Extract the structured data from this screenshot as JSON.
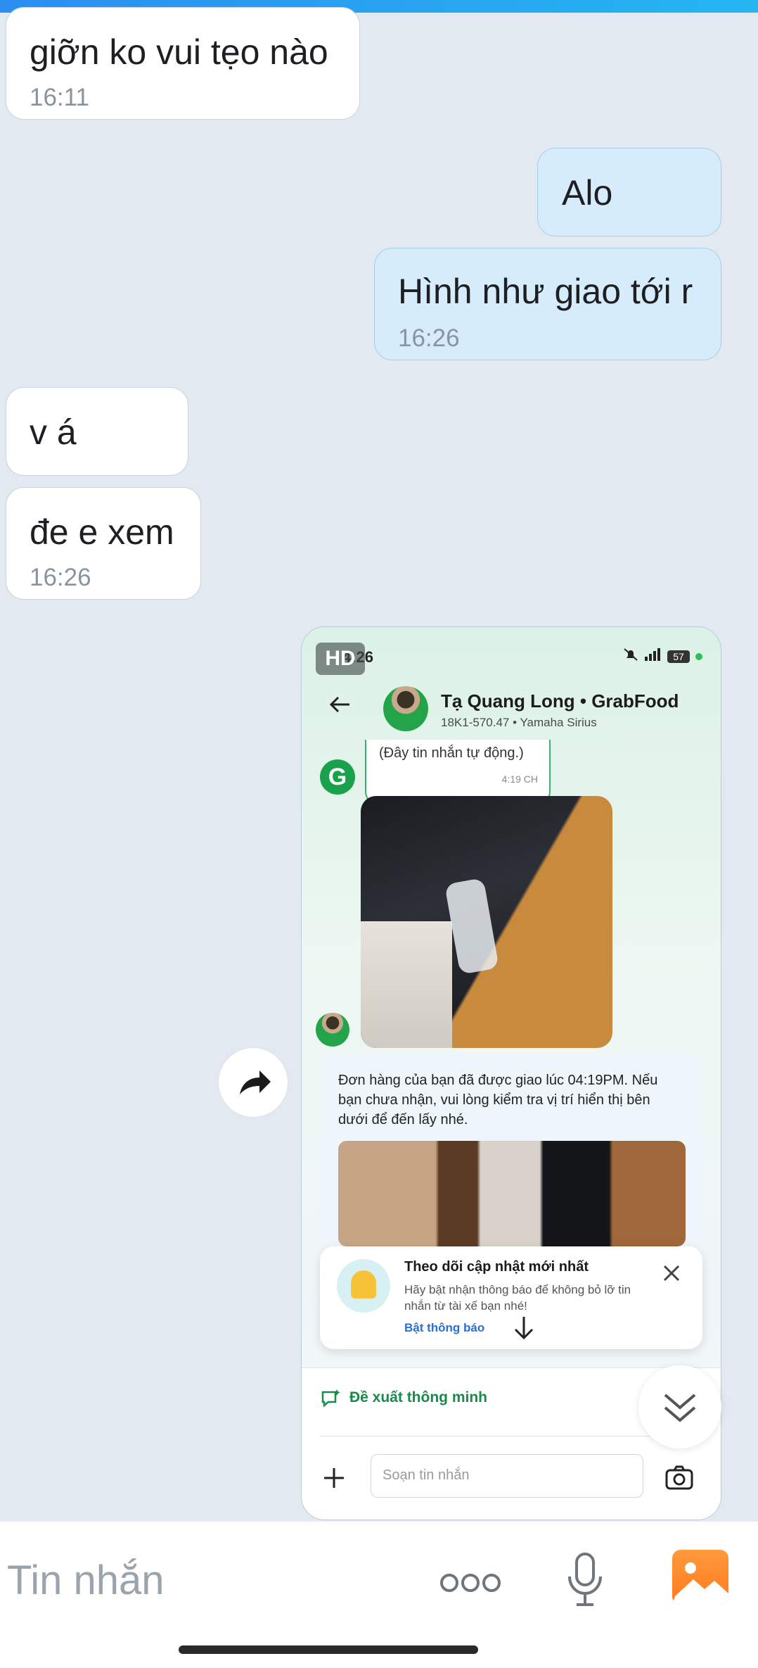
{
  "messages": [
    {
      "text": "giỡn ko vui tẹo nào",
      "time": "16:11"
    },
    {
      "text": "Alo"
    },
    {
      "text": "Hình như giao tới r",
      "time": "16:26"
    },
    {
      "text": "v á"
    },
    {
      "text": "đe e xem",
      "time": "16:26"
    }
  ],
  "screenshot": {
    "hd_badge": "HD",
    "status_time": "4:26",
    "battery": "57",
    "driver_name": "Tạ Quang Long • GrabFood",
    "driver_sub": "18K1-570.47 • Yamaha Sirius",
    "auto_msg": "(Đây tin nhắn tự động.)",
    "auto_time": "4:19 CH",
    "g_logo": "G",
    "order_text": "Đơn hàng của bạn đã được giao lúc 04:19PM. Nếu bạn chưa nhận, vui lòng kiểm tra vị trí hiển thị bên dưới để đến lấy nhé.",
    "notif_title": "Theo dõi cập nhật mới nhất",
    "notif_body": "Hãy bật nhận thông báo để không bỏ lỡ tin nhắn từ tài xế bạn nhé!",
    "notif_action": "Bật thông báo",
    "suggest_label": "Đề xuất thông minh",
    "input_placeholder": "Soạn tin nhắn"
  },
  "composer": {
    "placeholder": "Tin nhắn"
  }
}
